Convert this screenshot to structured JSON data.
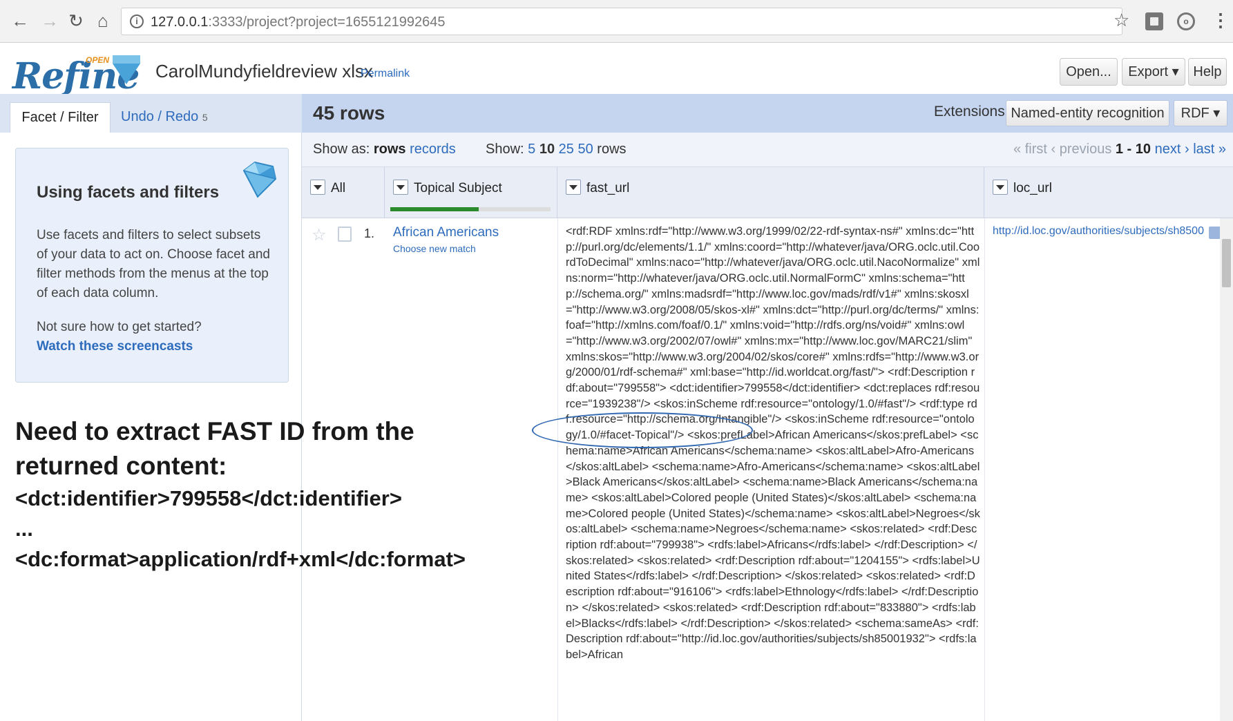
{
  "browser": {
    "url_host": "127.0.0.1",
    "url_rest": ":3333/project?project=1655121992645"
  },
  "app": {
    "logo_text": "Refine",
    "logo_badge": "OPEN",
    "project_name": "CarolMundyfieldreview xlsx",
    "permalink": "Permalink",
    "buttons": {
      "open": "Open...",
      "export": "Export ▾",
      "help": "Help"
    }
  },
  "left_panel": {
    "tab_facet": "Facet / Filter",
    "tab_undo": "Undo / Redo",
    "undo_count": "5",
    "help_title": "Using facets and filters",
    "help_body": "Use facets and filters to select subsets of your data to act on. Choose facet and filter methods from the menus at the top of each data column.",
    "help_question": "Not sure how to get started?",
    "help_link": "Watch these screencasts"
  },
  "annotation": {
    "line1": "Need to extract FAST ID from the",
    "line2": "returned content:",
    "line3": "<dct:identifier>799558</dct:identifier>",
    "line4": "...",
    "line5": "<dc:format>application/rdf+xml</dc:format>"
  },
  "grid": {
    "rows_count": "45 rows",
    "extensions_label": "Extensions:",
    "ner_button": "Named-entity recognition ▾",
    "rdf_button": "RDF ▾",
    "show_as_label": "Show as:",
    "show_as_rows": "rows",
    "show_as_records": "records",
    "show_label": "Show:",
    "show_5": "5",
    "show_10": "10",
    "show_25": "25",
    "show_50": "50",
    "show_rows_suffix": "rows",
    "pager_first": "« first",
    "pager_prev": "‹ previous",
    "pager_range": "1 - 10",
    "pager_next": "next ›",
    "pager_last": "last »",
    "columns": [
      "All",
      "Topical Subject",
      "fast_url",
      "loc_url"
    ],
    "recon_progress": 0.55
  },
  "row": {
    "number": "1.",
    "topical_subject": "African Americans",
    "choose_match": "Choose new match",
    "fast_url": "<rdf:RDF xmlns:rdf=\"http://www.w3.org/1999/02/22-rdf-syntax-ns#\" xmlns:dc=\"http://purl.org/dc/elements/1.1/\" xmlns:coord=\"http://whatever/java/ORG.oclc.util.CoordToDecimal\" xmlns:naco=\"http://whatever/java/ORG.oclc.util.NacoNormalize\" xmlns:norm=\"http://whatever/java/ORG.oclc.util.NormalFormC\" xmlns:schema=\"http://schema.org/\" xmlns:madsrdf=\"http://www.loc.gov/mads/rdf/v1#\" xmlns:skosxl=\"http://www.w3.org/2008/05/skos-xl#\" xmlns:dct=\"http://purl.org/dc/terms/\" xmlns:foaf=\"http://xmlns.com/foaf/0.1/\" xmlns:void=\"http://rdfs.org/ns/void#\" xmlns:owl=\"http://www.w3.org/2002/07/owl#\" xmlns:mx=\"http://www.loc.gov/MARC21/slim\" xmlns:skos=\"http://www.w3.org/2004/02/skos/core#\" xmlns:rdfs=\"http://www.w3.org/2000/01/rdf-schema#\" xml:base=\"http://id.worldcat.org/fast/\"> <rdf:Description rdf:about=\"799558\"> <dct:identifier>799558</dct:identifier> <dct:replaces rdf:resource=\"1939238\"/> <skos:inScheme rdf:resource=\"ontology/1.0/#fast\"/> <rdf:type rdf:resource=\"http://schema.org/Intangible\"/> <skos:inScheme rdf:resource=\"ontology/1.0/#facet-Topical\"/> <skos:prefLabel>African Americans</skos:prefLabel> <schema:name>African Americans</schema:name> <skos:altLabel>Afro-Americans</skos:altLabel> <schema:name>Afro-Americans</schema:name> <skos:altLabel>Black Americans</skos:altLabel> <schema:name>Black Americans</schema:name> <skos:altLabel>Colored people (United States)</skos:altLabel> <schema:name>Colored people (United States)</schema:name> <skos:altLabel>Negroes</skos:altLabel> <schema:name>Negroes</schema:name> <skos:related> <rdf:Description rdf:about=\"799938\"> <rdfs:label>Africans</rdfs:label> </rdf:Description> </skos:related> <skos:related> <rdf:Description rdf:about=\"1204155\"> <rdfs:label>United States</rdfs:label> </rdf:Description> </skos:related> <skos:related> <rdf:Description rdf:about=\"916106\"> <rdfs:label>Ethnology</rdfs:label> </rdf:Description> </skos:related> <skos:related> <rdf:Description rdf:about=\"833880\"> <rdfs:label>Blacks</rdfs:label> </rdf:Description> </skos:related> <schema:sameAs> <rdf:Description rdf:about=\"http://id.loc.gov/authorities/subjects/sh85001932\"> <rdfs:label>African",
    "loc_url": "http://id.loc.gov/authorities/subjects/sh8500"
  },
  "colors": {
    "accent_blue": "#2d6bbd",
    "header_bar": "#c5d4ef",
    "recon_green": "#2b8a2b",
    "annotation_ellipse": "#2f67b1"
  },
  "icons": [
    "back-icon",
    "forward-icon",
    "reload-icon",
    "home-icon",
    "info-icon",
    "star-icon",
    "extension-icon",
    "menu-icon",
    "gem-icon",
    "dropdown-icon",
    "flag-icon",
    "edit-icon"
  ]
}
